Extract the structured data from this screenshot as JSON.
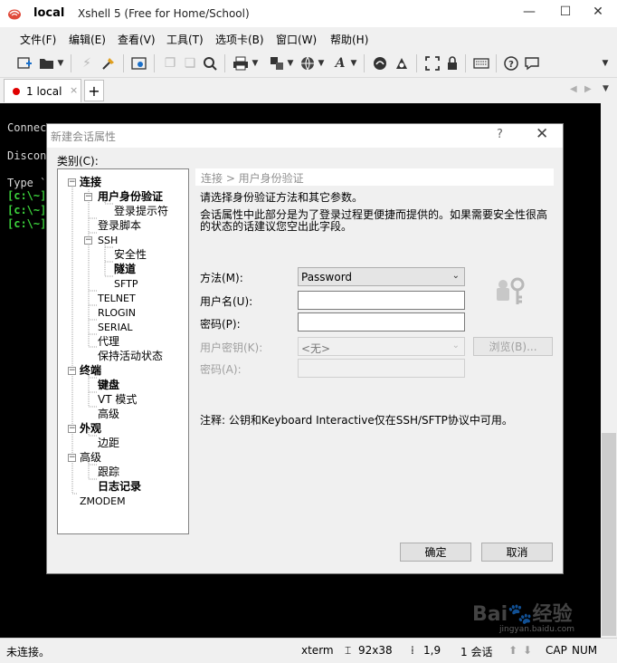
{
  "window": {
    "title_main": "local",
    "title_sub": "Xshell 5 (Free for Home/School)",
    "btn_minimize": "—",
    "btn_maximize": "☐",
    "btn_close": "✕"
  },
  "menu": {
    "items": [
      "文件(F)",
      "编辑(E)",
      "查看(V)",
      "工具(T)",
      "选项卡(B)",
      "窗口(W)",
      "帮助(H)"
    ]
  },
  "toolbar": {
    "icons": [
      "new-session-icon",
      "open-folder-icon",
      "disconnect-icon",
      "reconnect-icon",
      "properties-icon",
      "copy-icon",
      "paste-icon",
      "find-icon",
      "print-icon",
      "transfer-icon",
      "globe-icon",
      "font-icon",
      "xftp-icon",
      "xmanager-icon",
      "fullscreen-icon",
      "lock-icon",
      "keyboard-icon",
      "help-icon",
      "chat-icon"
    ]
  },
  "tabs": {
    "active_label": "1 local",
    "close_glyph": "×",
    "add_glyph": "+"
  },
  "terminal": {
    "lines": [
      {
        "text": "Connect",
        "green": false
      },
      {
        "text": "Discon",
        "green": false
      },
      {
        "text": "Type `",
        "green": false
      },
      {
        "text": "[c:\\~]",
        "green": true
      },
      {
        "text": "[c:\\~]",
        "green": true
      },
      {
        "text": "[c:\\~]",
        "green": true
      }
    ]
  },
  "status": {
    "left": "未连接。",
    "term": "xterm",
    "size_icon": "⌶",
    "size": "92x38",
    "cursor_icon": "⁞",
    "cursor": "1,9",
    "sessions": "1 会话",
    "caps": "CAP",
    "num": "NUM"
  },
  "dialog": {
    "title": "新建会话属性",
    "help": "?",
    "close": "✕",
    "category_label": "类别(C):",
    "tree": [
      {
        "label": "连接",
        "level": 0,
        "bold": true,
        "expander": "−"
      },
      {
        "label": "用户身份验证",
        "level": 1,
        "bold": true,
        "expander": "−",
        "selected": true
      },
      {
        "label": "登录提示符",
        "level": 2,
        "bold": false
      },
      {
        "label": "登录脚本",
        "level": 1,
        "bold": false
      },
      {
        "label": "SSH",
        "level": 1,
        "bold": false,
        "expander": "−",
        "small": true
      },
      {
        "label": "安全性",
        "level": 2,
        "bold": false
      },
      {
        "label": "隧道",
        "level": 2,
        "bold": true
      },
      {
        "label": "SFTP",
        "level": 2,
        "bold": false,
        "small": true
      },
      {
        "label": "TELNET",
        "level": 1,
        "bold": false,
        "small": true
      },
      {
        "label": "RLOGIN",
        "level": 1,
        "bold": false,
        "small": true
      },
      {
        "label": "SERIAL",
        "level": 1,
        "bold": false,
        "small": true
      },
      {
        "label": "代理",
        "level": 1,
        "bold": false
      },
      {
        "label": "保持活动状态",
        "level": 1,
        "bold": false
      },
      {
        "label": "终端",
        "level": 0,
        "bold": true,
        "expander": "−"
      },
      {
        "label": "键盘",
        "level": 1,
        "bold": true
      },
      {
        "label": "VT 模式",
        "level": 1,
        "bold": false
      },
      {
        "label": "高级",
        "level": 1,
        "bold": false
      },
      {
        "label": "外观",
        "level": 0,
        "bold": true,
        "expander": "−"
      },
      {
        "label": "边距",
        "level": 1,
        "bold": false
      },
      {
        "label": "高级",
        "level": 0,
        "bold": false,
        "expander": "−"
      },
      {
        "label": "跟踪",
        "level": 1,
        "bold": false
      },
      {
        "label": "日志记录",
        "level": 1,
        "bold": true
      },
      {
        "label": "ZMODEM",
        "level": 0,
        "bold": false,
        "small": true
      }
    ],
    "section_header": "连接 > 用户身份验证",
    "desc1": "请选择身份验证方法和其它参数。",
    "desc2a": "会话属性中此部分是为了登录过程更便捷而提供的。如果需要安全性很高",
    "desc2b": "的状态的话建议您空出此字段。",
    "method_label": "方法(M):",
    "method_value": "Password",
    "username_label": "用户名(U):",
    "username_value": "",
    "password_label": "密码(P):",
    "password_value": "",
    "userkey_label": "用户密钥(K):",
    "userkey_value": "<无>",
    "browse_label": "浏览(B)...",
    "passphrase_label": "密码(A):",
    "passphrase_value": "",
    "note": "注释: 公钥和Keyboard Interactive仅在SSH/SFTP协议中可用。",
    "ok_label": "确定",
    "cancel_label": "取消"
  },
  "watermark": {
    "text": "Bai🐾经验",
    "sub": "jingyan.baidu.com"
  }
}
